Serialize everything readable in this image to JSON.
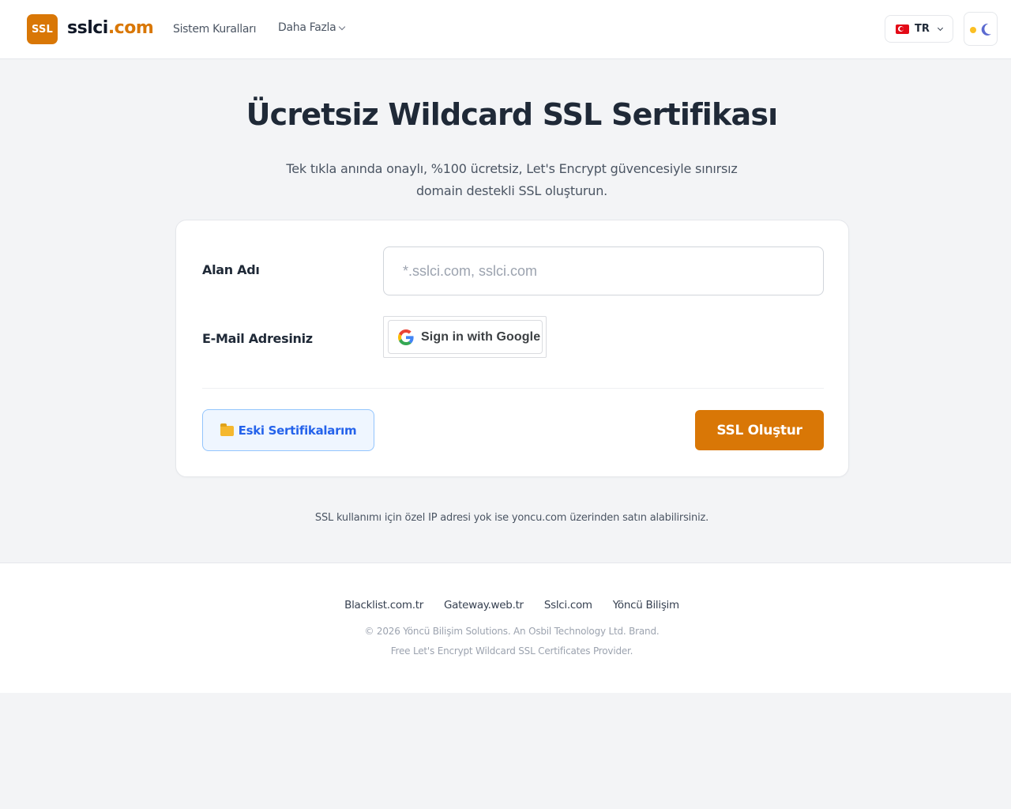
{
  "header": {
    "logo_text": "SSL",
    "brand_main": "sslci",
    "brand_tld": ".com",
    "nav": {
      "rules": "Sistem Kuralları",
      "more": "Daha Fazla"
    },
    "language": "TR",
    "theme_icons": [
      "sun-icon",
      "moon-icon"
    ],
    "colors": {
      "accent": "#d97706",
      "moon": "#5b6ad0",
      "sun": "#fbbf24"
    }
  },
  "hero": {
    "title": "Ücretsiz Wildcard SSL Sertifikası",
    "subtitle": "Tek tıkla anında onaylı, %100 ücretsiz, Let's Encrypt güvencesiyle sınırsız domain destekli SSL oluşturun."
  },
  "form": {
    "domain_label": "Alan Adı",
    "domain_value": "",
    "domain_placeholder": "*.sslci.com, sslci.com",
    "email_label": "E-Mail Adresiniz",
    "google_button": "Sign in with Google",
    "old_certs_icon": "📁",
    "old_certs_button": "Eski Sertifikalarım",
    "submit_button": "SSL Oluştur"
  },
  "note": "SSL kullanımı için özel IP adresi yok ise yoncu.com üzerinden satın alabilirsiniz.",
  "footer": {
    "links": [
      "Blacklist.com.tr",
      "Gateway.web.tr",
      "Sslci.com",
      "Yöncü Bilişim"
    ],
    "copyright": "© 2026 Yöncü Bilişim Solutions. An Osbil Technology Ltd. Brand.",
    "tagline": "Free Let's Encrypt Wildcard SSL Certificates Provider."
  }
}
